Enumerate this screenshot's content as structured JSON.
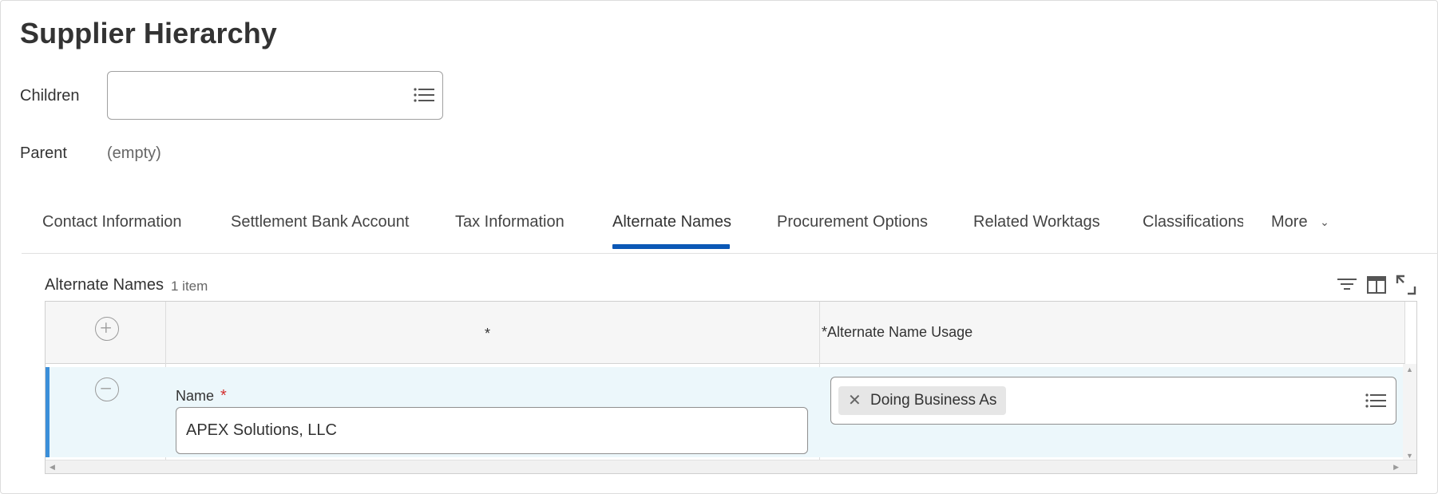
{
  "page": {
    "title": "Supplier Hierarchy",
    "children_label": "Children",
    "children_value": "",
    "parent_label": "Parent",
    "parent_value": "(empty)"
  },
  "tabs": [
    {
      "label": "Contact Information",
      "active": false
    },
    {
      "label": "Settlement Bank Account",
      "active": false
    },
    {
      "label": "Tax Information",
      "active": false
    },
    {
      "label": "Alternate Names",
      "active": true
    },
    {
      "label": "Procurement Options",
      "active": false
    },
    {
      "label": "Related Worktags",
      "active": false
    },
    {
      "label": "Classifications",
      "active": false
    }
  ],
  "more_tab": {
    "label": "More"
  },
  "grid": {
    "title": "Alternate Names",
    "count": "1 item",
    "columns": {
      "name": "*",
      "usage": "*Alternate Name Usage"
    },
    "rows": [
      {
        "name_label": "Name",
        "required_marker": "*",
        "name_value": "APEX Solutions, LLC",
        "usage_selected": "Doing Business As"
      }
    ]
  },
  "icons": {
    "prompt": "list-icon",
    "add": "plus-circle-icon",
    "remove": "minus-circle-icon",
    "filter": "filter-icon",
    "columns": "columns-icon",
    "fullscreen": "expand-icon",
    "remove_pill": "close-icon"
  },
  "colors": {
    "accent": "#0b58b6",
    "row_highlight": "#ecf7fb",
    "row_marker": "#3b8fd9",
    "required": "#d32f2f"
  }
}
